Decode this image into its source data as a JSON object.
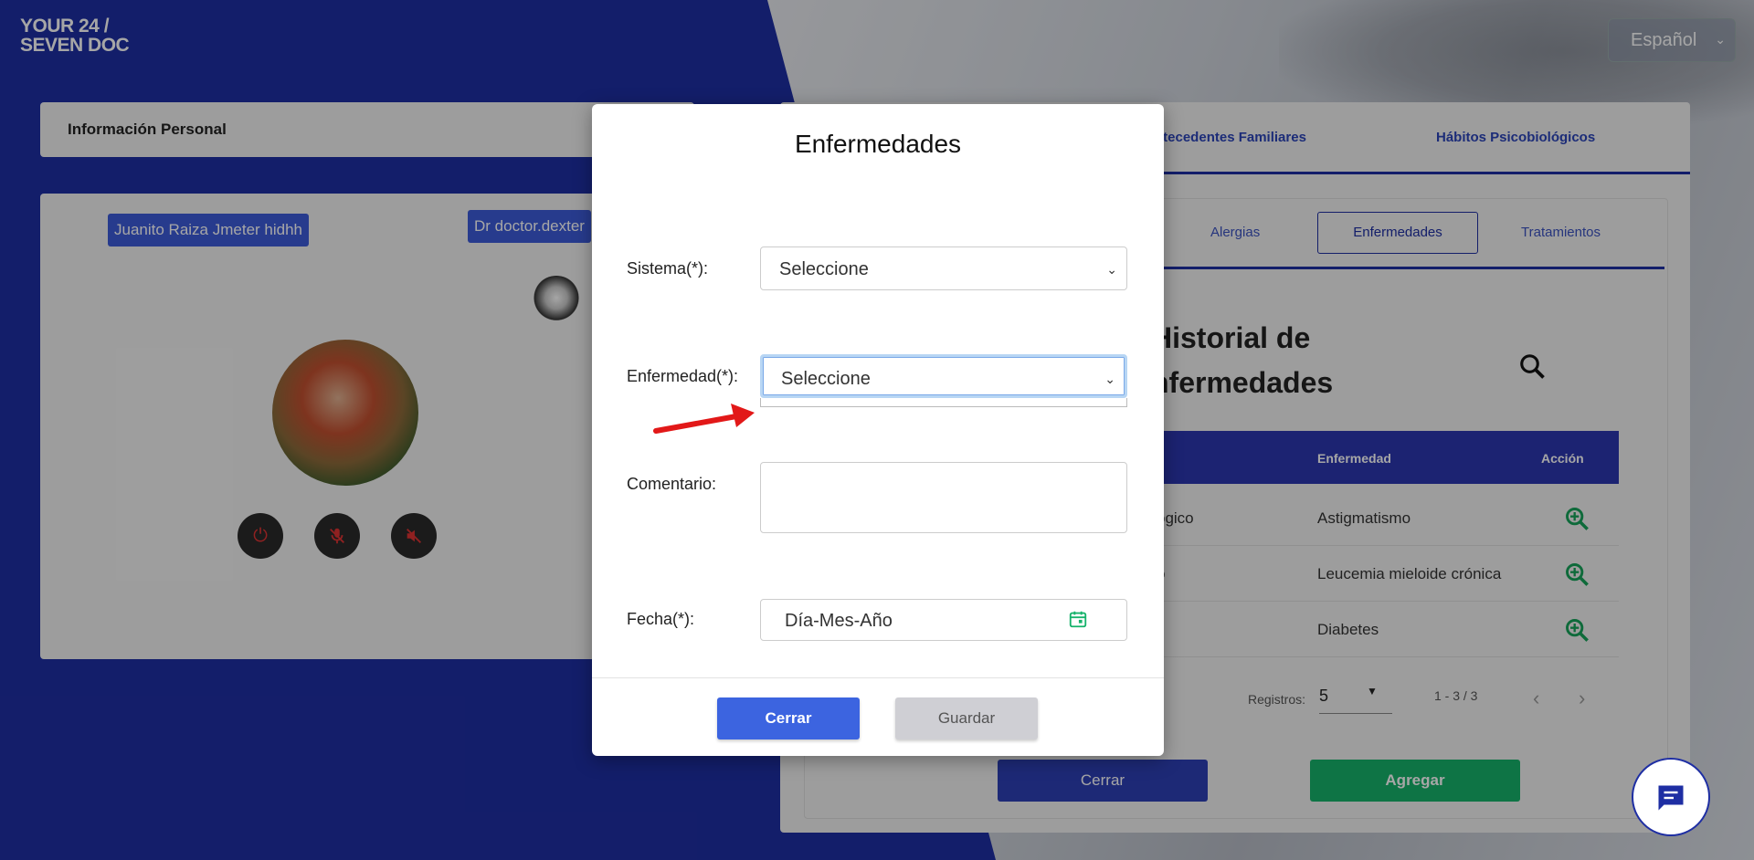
{
  "brand": {
    "logo_line1": "YOUR 24 /",
    "logo_line2": "SEVEN DOC"
  },
  "language": {
    "value": "Español"
  },
  "left_panel": {
    "info_title": "Información Personal",
    "patient_tag": "Juanito Raiza Jmeter hidhh",
    "doctor_tag": "Dr doctor.dexter"
  },
  "right_panel": {
    "tabs": [
      "ntecedentes Familiares",
      "Hábitos Psicobiológicos"
    ],
    "subtabs": [
      "Alergias",
      "Enfermedades",
      "Tratamientos"
    ],
    "history_title_line1": "Historial de",
    "history_title_line2": "nfermedades",
    "table": {
      "headers": [
        "Enfermedad",
        "Acción"
      ],
      "rows": [
        {
          "c1": "ogico",
          "c2": "Astigmatismo"
        },
        {
          "c1": "o",
          "c2": "Leucemia mieloide crónica"
        },
        {
          "c1": "",
          "c2": "Diabetes"
        }
      ]
    },
    "pagination": {
      "label": "Registros:",
      "per_page": "5",
      "range": "1 - 3 / 3"
    },
    "cerrar_label": "Cerrar",
    "agregar_label": "Agregar"
  },
  "modal": {
    "title": "Enfermedades",
    "sistema_label": "Sistema(*):",
    "sistema_value": "Seleccione",
    "enfermedad_label": "Enfermedad(*):",
    "enfermedad_value": "Seleccione",
    "comentario_label": "Comentario:",
    "fecha_label": "Fecha(*):",
    "fecha_placeholder": "Día-Mes-Año",
    "cerrar_label": "Cerrar",
    "guardar_label": "Guardar"
  },
  "colors": {
    "primary": "#1e2ea3",
    "button_blue": "#3c64e0",
    "green": "#16b36b",
    "arrow": "#e21818"
  }
}
